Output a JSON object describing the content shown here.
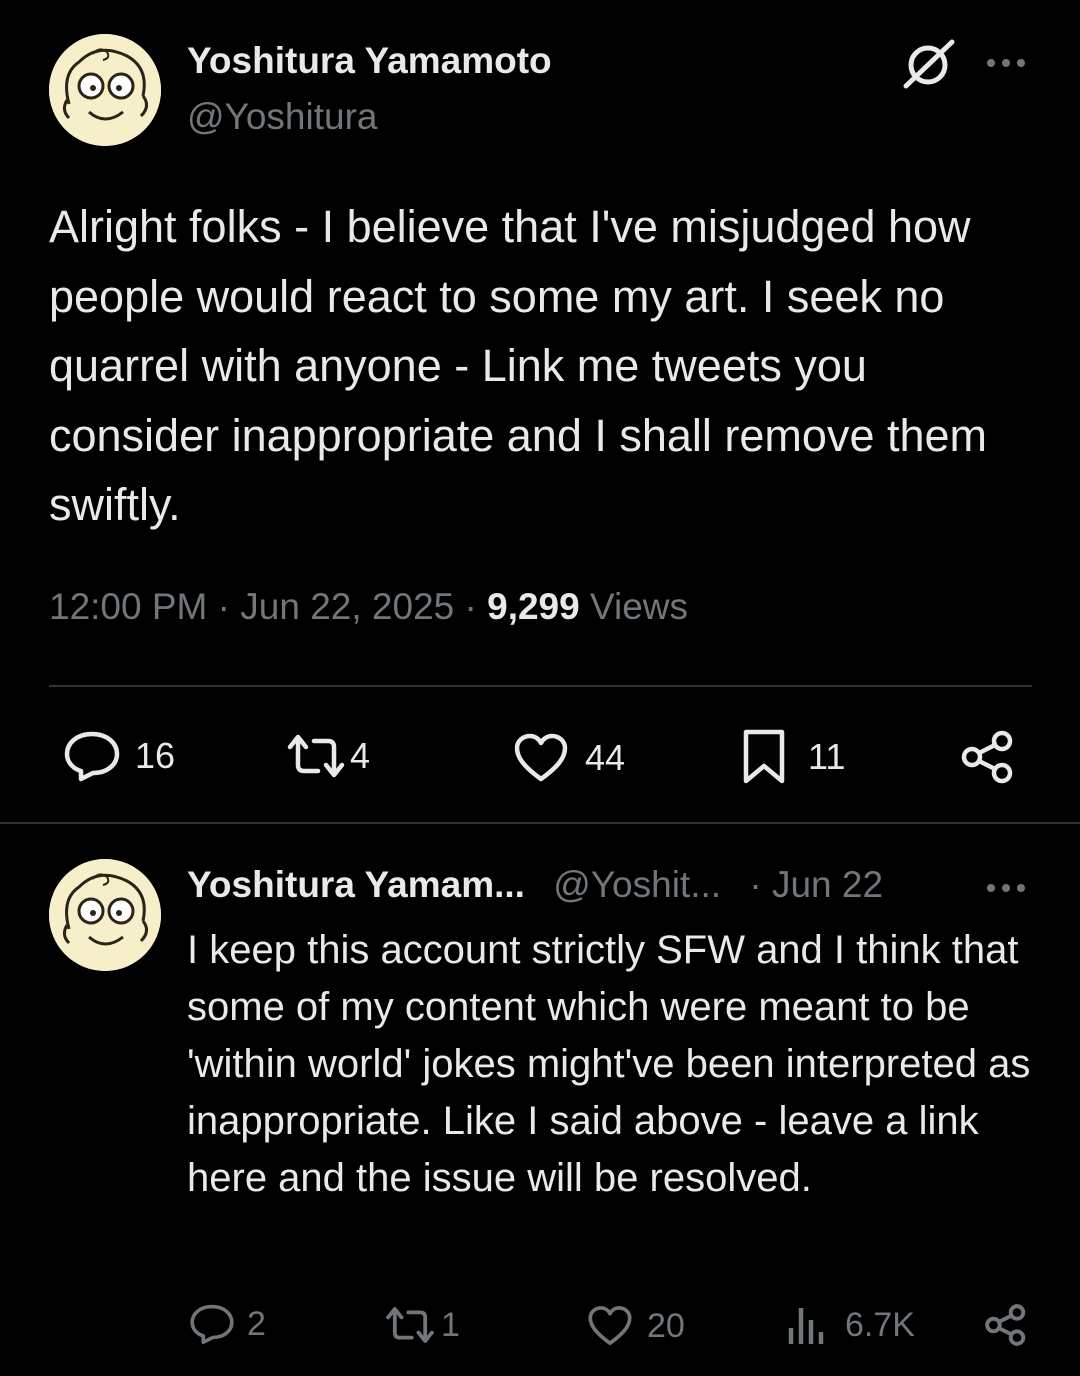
{
  "main_tweet": {
    "display_name": "Yoshitura Yamamoto",
    "handle": "@Yoshitura",
    "text": "Alright folks - I believe that I've misjudged how people would react to some my art. I seek no quarrel with anyone - Link me tweets you consider inappropriate and I shall remove them swiftly.",
    "time": "12:00 PM",
    "separator": "·",
    "date": "Jun 22, 2025",
    "views_count": "9,299",
    "views_label": "Views",
    "replies": "16",
    "retweets": "4",
    "likes": "44",
    "bookmarks": "11"
  },
  "reply_tweet": {
    "display_name": "Yoshitura Yamam...",
    "handle": "@Yoshit...",
    "date": "· Jun 22",
    "text": "I keep this account strictly SFW and I think that some of my content which were meant to be 'within world' jokes might've been interpreted as inappropriate. Like I said above - leave a link here and the issue will be resolved.",
    "replies": "2",
    "retweets": "1",
    "likes": "20",
    "views": "6.7K"
  },
  "colors": {
    "background": "#000000",
    "text": "#e7e9ea",
    "muted": "#71767b",
    "divider": "#2f3336"
  },
  "icons": [
    "grok-icon",
    "more-icon",
    "reply-icon",
    "retweet-icon",
    "like-icon",
    "bookmark-icon",
    "share-icon",
    "views-icon"
  ]
}
